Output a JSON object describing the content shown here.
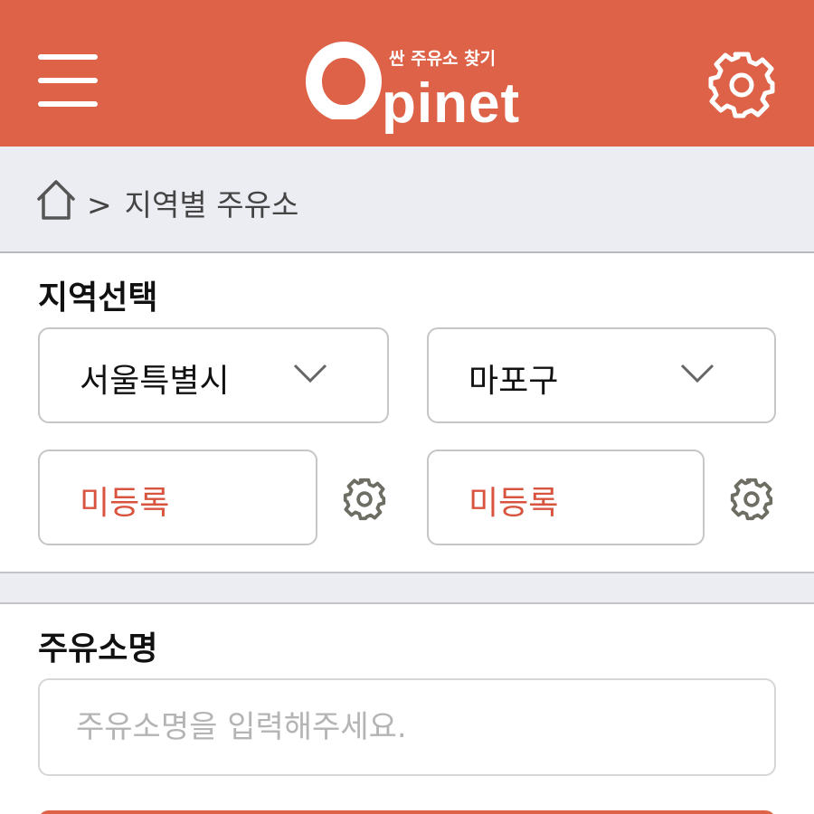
{
  "header": {
    "logo_subtitle": "싼 주유소 찾기",
    "logo_text": "pinet",
    "brand_color": "#dd6247",
    "menu_icon": "hamburger-menu-icon",
    "settings_icon": "gear-icon"
  },
  "breadcrumb": {
    "home_icon": "home-icon",
    "separator": ">",
    "current": "지역별 주유소"
  },
  "region": {
    "title": "지역선택",
    "city_select": {
      "value": "서울특별시",
      "icon": "chevron-down-icon"
    },
    "district_select": {
      "value": "마포구",
      "icon": "chevron-down-icon"
    },
    "favorite_1": {
      "value": "미등록",
      "icon": "gear-icon"
    },
    "favorite_2": {
      "value": "미등록",
      "icon": "gear-icon"
    },
    "unregistered_color": "#d9543e"
  },
  "station_name": {
    "title": "주유소명",
    "input_value": "",
    "placeholder": "주유소명을 입력해주세요."
  }
}
